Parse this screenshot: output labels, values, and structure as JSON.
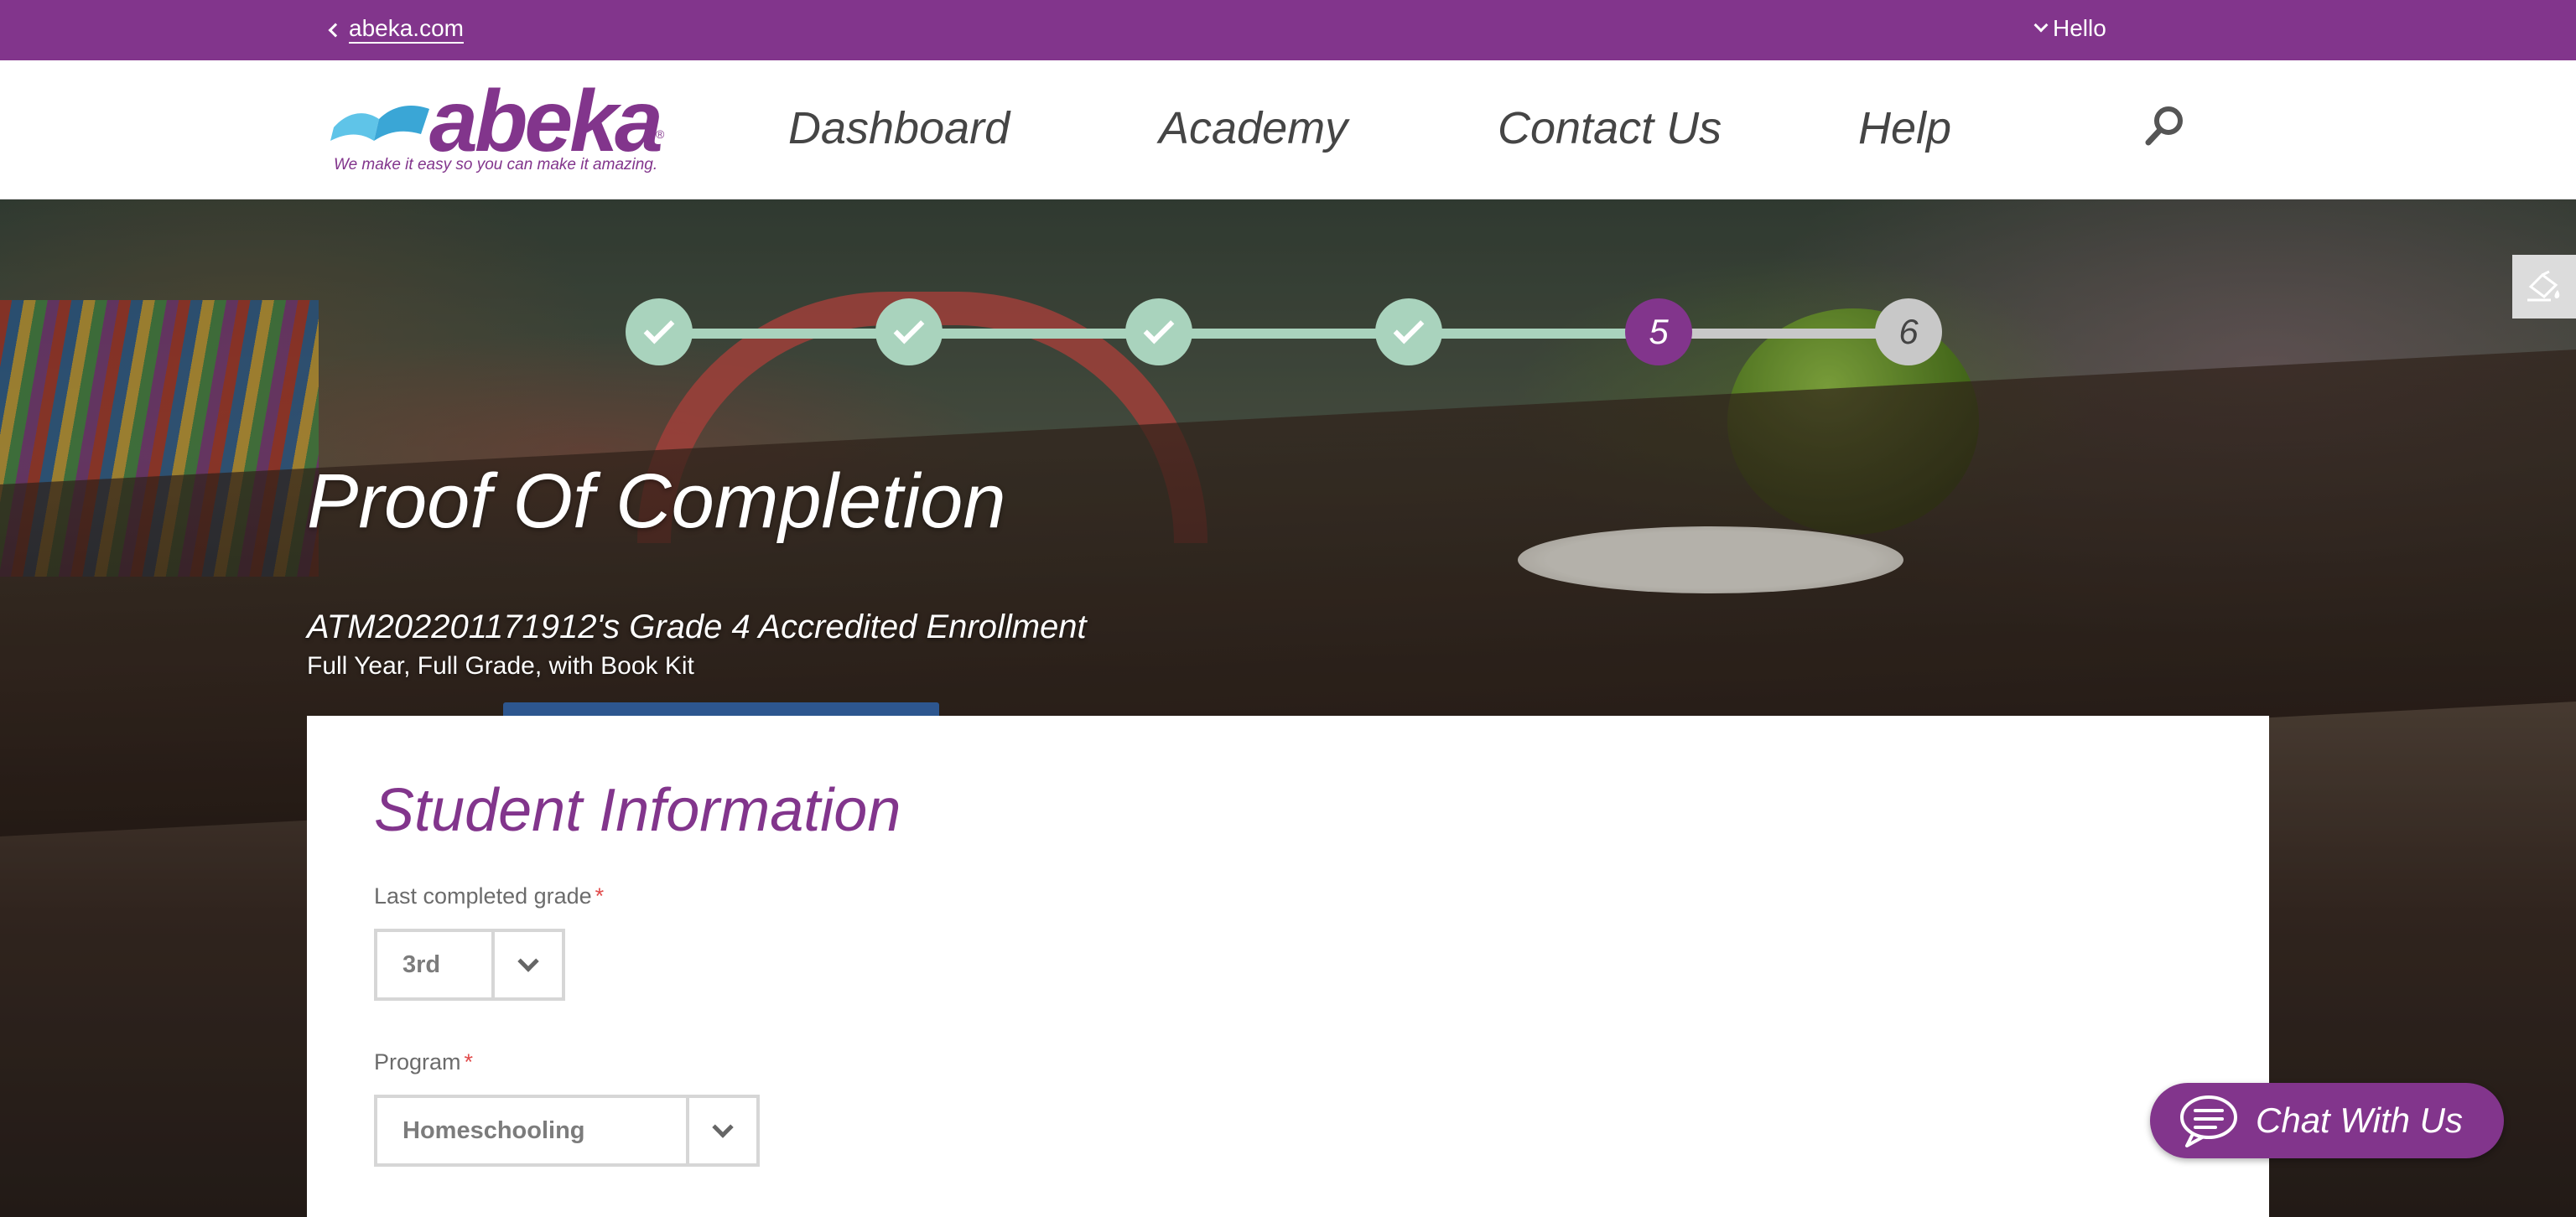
{
  "topbar": {
    "back_link": "abeka.com",
    "greeting": "Hello"
  },
  "brand": {
    "name": "abeka",
    "registered": "®",
    "tagline": "We make it easy so you can make it amazing.",
    "color": "#82358c"
  },
  "nav": {
    "items": [
      {
        "label": "Dashboard"
      },
      {
        "label": "Academy"
      },
      {
        "label": "Contact Us"
      },
      {
        "label": "Help"
      }
    ],
    "search_icon": "search-icon"
  },
  "progress": {
    "steps": [
      {
        "number": "1",
        "status": "complete"
      },
      {
        "number": "2",
        "status": "complete"
      },
      {
        "number": "3",
        "status": "complete"
      },
      {
        "number": "4",
        "status": "complete"
      },
      {
        "number": "5",
        "status": "current"
      },
      {
        "number": "6",
        "status": "upcoming"
      }
    ],
    "colors": {
      "complete": "#a9d3bd",
      "current": "#82358c",
      "upcoming": "#c8c8c8"
    }
  },
  "page": {
    "title": "Proof Of Completion",
    "enrollment": "ATM202201171912's Grade 4 Accredited Enrollment",
    "enrollment_detail": "Full Year, Full Grade, with Book Kit"
  },
  "form": {
    "section_title": "Student Information",
    "fields": [
      {
        "label": "Last completed grade",
        "required_mark": "*",
        "value": "3rd"
      },
      {
        "label": "Program",
        "required_mark": "*",
        "value": "Homeschooling"
      }
    ]
  },
  "chat": {
    "label": "Chat With Us",
    "icon": "chat-bubble-icon"
  },
  "side_tab": {
    "icon": "paint-bucket-icon"
  }
}
